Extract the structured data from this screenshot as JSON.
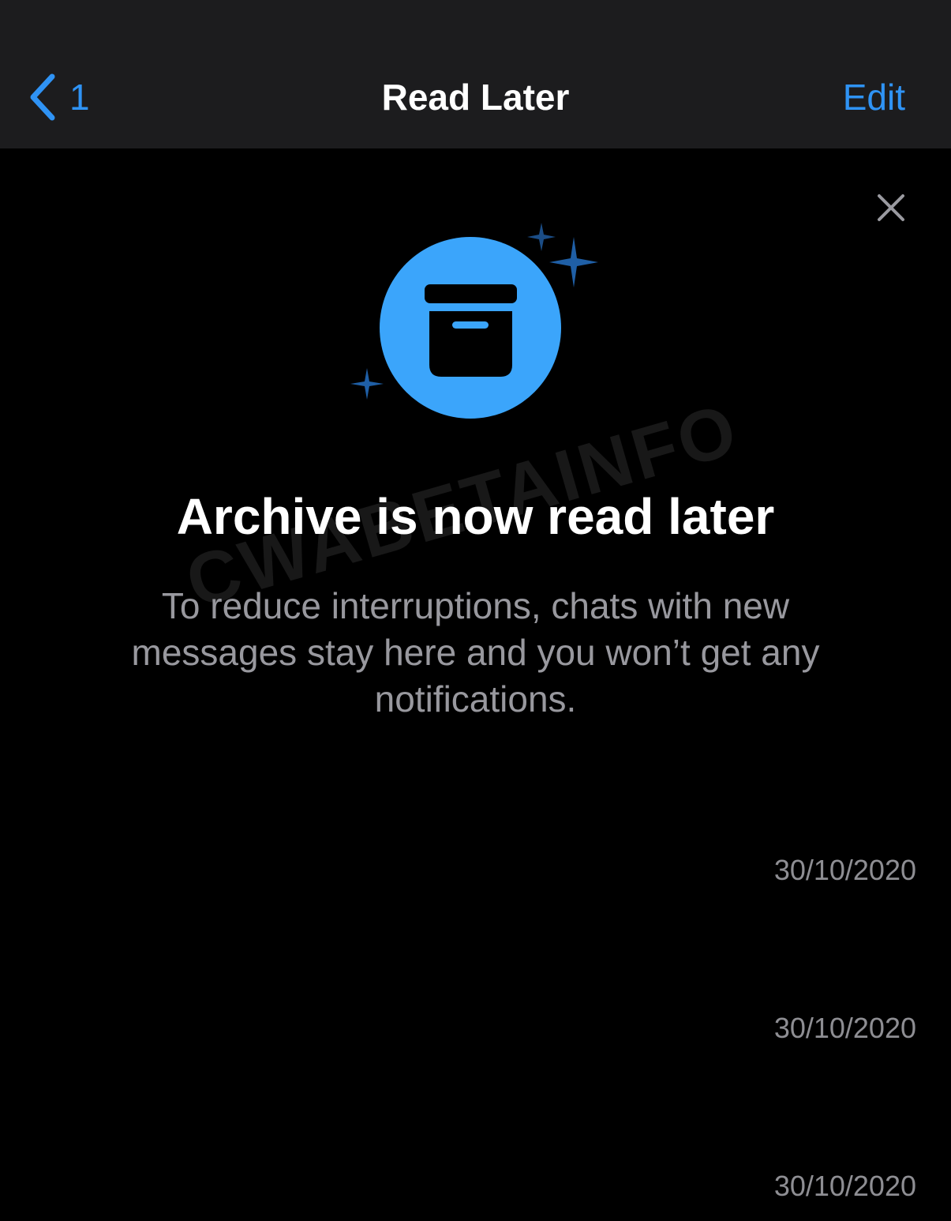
{
  "navbar": {
    "back_count": "1",
    "title": "Read Later",
    "edit_label": "Edit"
  },
  "banner": {
    "icon": "archive-box-icon",
    "headline": "Archive is now read later",
    "description": "To reduce interruptions, chats with new messages stay here and you won’t get any notifications.",
    "close_icon": "close-icon"
  },
  "watermark": "CWABETAINFO",
  "chats": [
    {
      "date": "30/10/2020"
    },
    {
      "date": "30/10/2020"
    },
    {
      "date": "30/10/2020"
    }
  ],
  "colors": {
    "accent": "#2f93f5",
    "navbar_bg": "#1c1c1e",
    "background": "#000000",
    "icon_circle": "#3ba5fb",
    "secondary_text": "#98989e"
  }
}
